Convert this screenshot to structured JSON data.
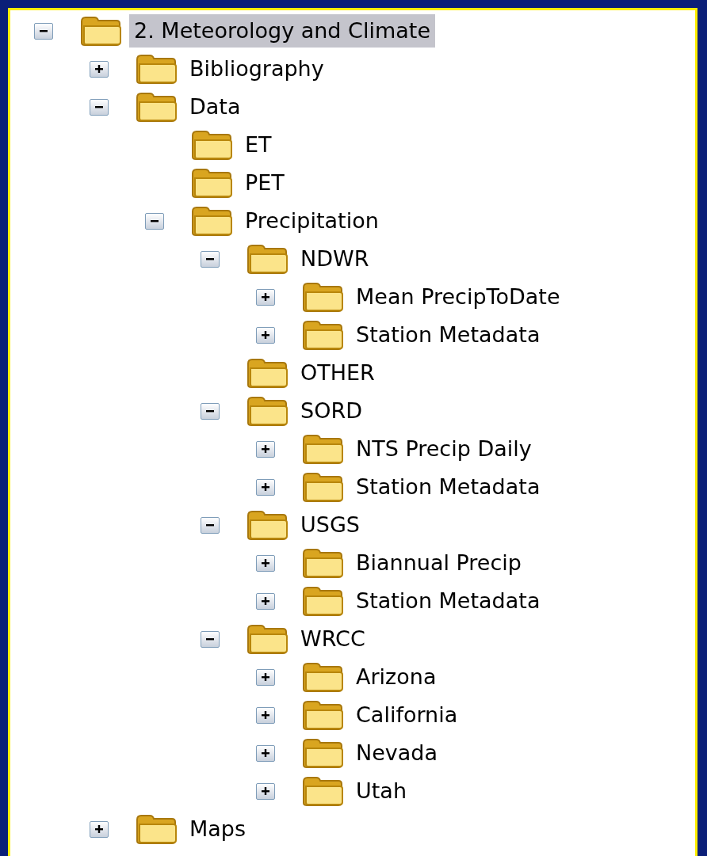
{
  "tree": [
    {
      "label": "2. Meteorology and Climate",
      "kind": "branch",
      "expanded": true,
      "selected": true,
      "children": [
        {
          "label": "Bibliography",
          "kind": "branch",
          "expanded": false,
          "selected": false
        },
        {
          "label": "Data",
          "kind": "branch",
          "expanded": true,
          "selected": false,
          "children": [
            {
              "label": "ET",
              "kind": "leaf",
              "selected": false
            },
            {
              "label": "PET",
              "kind": "leaf",
              "selected": false
            },
            {
              "label": "Precipitation",
              "kind": "branch",
              "expanded": true,
              "selected": false,
              "children": [
                {
                  "label": "NDWR",
                  "kind": "branch",
                  "expanded": true,
                  "selected": false,
                  "children": [
                    {
                      "label": "Mean PrecipToDate",
                      "kind": "branch",
                      "expanded": false,
                      "selected": false
                    },
                    {
                      "label": "Station Metadata",
                      "kind": "branch",
                      "expanded": false,
                      "selected": false
                    }
                  ]
                },
                {
                  "label": "OTHER",
                  "kind": "leaf",
                  "selected": false
                },
                {
                  "label": "SORD",
                  "kind": "branch",
                  "expanded": true,
                  "selected": false,
                  "children": [
                    {
                      "label": "NTS Precip Daily",
                      "kind": "branch",
                      "expanded": false,
                      "selected": false
                    },
                    {
                      "label": "Station Metadata",
                      "kind": "branch",
                      "expanded": false,
                      "selected": false
                    }
                  ]
                },
                {
                  "label": "USGS",
                  "kind": "branch",
                  "expanded": true,
                  "selected": false,
                  "children": [
                    {
                      "label": "Biannual Precip",
                      "kind": "branch",
                      "expanded": false,
                      "selected": false
                    },
                    {
                      "label": "Station Metadata",
                      "kind": "branch",
                      "expanded": false,
                      "selected": false
                    }
                  ]
                },
                {
                  "label": "WRCC",
                  "kind": "branch",
                  "expanded": true,
                  "selected": false,
                  "children": [
                    {
                      "label": "Arizona",
                      "kind": "branch",
                      "expanded": false,
                      "selected": false
                    },
                    {
                      "label": "California",
                      "kind": "branch",
                      "expanded": false,
                      "selected": false
                    },
                    {
                      "label": "Nevada",
                      "kind": "branch",
                      "expanded": false,
                      "selected": false
                    },
                    {
                      "label": "Utah",
                      "kind": "branch",
                      "expanded": false,
                      "selected": false
                    }
                  ]
                }
              ]
            }
          ]
        },
        {
          "label": "Maps",
          "kind": "branch",
          "expanded": false,
          "selected": false
        }
      ]
    }
  ]
}
